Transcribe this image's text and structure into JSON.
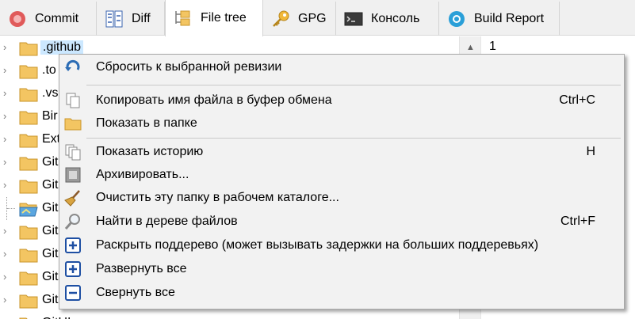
{
  "tabs": [
    {
      "label": "Commit",
      "icon": "commit-icon"
    },
    {
      "label": "Diff",
      "icon": "diff-icon"
    },
    {
      "label": "File tree",
      "icon": "file-tree-icon",
      "active": true
    },
    {
      "label": "GPG",
      "icon": "key-icon"
    },
    {
      "label": "Консоль",
      "icon": "console-icon"
    },
    {
      "label": "Build Report",
      "icon": "build-report-icon"
    }
  ],
  "tree": {
    "rows": [
      {
        "label": ".github",
        "selected": true,
        "icon": "folder-icon"
      },
      {
        "label": ".to",
        "icon": "folder-icon"
      },
      {
        "label": ".vs",
        "icon": "folder-icon"
      },
      {
        "label": "Bir",
        "icon": "folder-icon"
      },
      {
        "label": "Ext",
        "icon": "folder-icon"
      },
      {
        "label": "Git",
        "icon": "folder-icon"
      },
      {
        "label": "Git",
        "icon": "folder-icon"
      },
      {
        "label": "Git",
        "icon": "folder-open-icon",
        "leaf": true
      },
      {
        "label": "Git",
        "icon": "folder-icon"
      },
      {
        "label": "Git",
        "icon": "folder-icon"
      },
      {
        "label": "Git",
        "icon": "folder-icon"
      },
      {
        "label": "Git",
        "icon": "folder-icon"
      },
      {
        "label": "GitUI",
        "icon": "folder-icon"
      }
    ]
  },
  "editor": {
    "line_number": "1"
  },
  "menu": {
    "items": [
      {
        "label": "Сбросить к выбранной ревизии",
        "shortcut": "",
        "icon": "reset-icon"
      },
      {
        "label": "Копировать имя файла в буфер обмена",
        "shortcut": "Ctrl+C",
        "icon": "copy-icon"
      },
      {
        "label": "Показать в папке",
        "shortcut": "",
        "icon": "folder-icon"
      },
      {
        "label": "Показать историю",
        "shortcut": "H",
        "icon": "history-icon"
      },
      {
        "label": "Архивировать...",
        "shortcut": "",
        "icon": "archive-icon"
      },
      {
        "label": "Очистить эту папку в рабочем каталоге...",
        "shortcut": "",
        "icon": "broom-icon"
      },
      {
        "label": "Найти в дереве файлов",
        "shortcut": "Ctrl+F",
        "icon": "magnifier-icon"
      },
      {
        "label": "Раскрыть поддерево (может вызывать задержки на больших поддеревьях)",
        "shortcut": "",
        "icon": "plus-box-icon"
      },
      {
        "label": "Развернуть все",
        "shortcut": "",
        "icon": "plus-box-icon"
      },
      {
        "label": "Свернуть все",
        "shortcut": "",
        "icon": "minus-box-icon"
      }
    ]
  },
  "colors": {
    "selection": "#cce8ff",
    "menu_bg": "#f2f2f2",
    "tab_bar": "#f0f0f0",
    "box_icon": "#1e4fa3"
  }
}
